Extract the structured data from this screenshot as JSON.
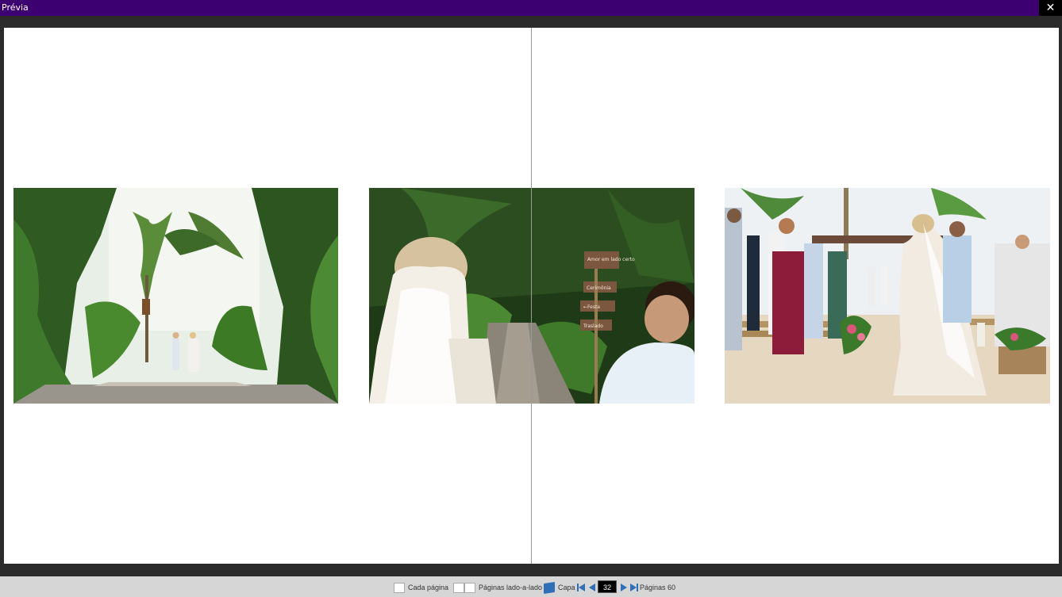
{
  "window": {
    "title": "Prévia",
    "close_label": "✕"
  },
  "spread": {
    "photos": [
      {
        "name": "bride-walkway-photo",
        "alt": "Noiva entrando pelo caminho tropical"
      },
      {
        "name": "bride-and-sign-photo",
        "alt": "Noiva e placa de madeira"
      },
      {
        "name": "beach-ceremony-photo",
        "alt": "Cerimônia na praia"
      }
    ],
    "sign_texts": [
      "Amor em lado certo",
      "Cerimônia",
      "←Festa",
      "Traslado"
    ]
  },
  "toolbar": {
    "each_page_label": "Cada página",
    "side_by_side_label": "Páginas lado-a-lado",
    "cover_label": "Capa",
    "current_page": "32",
    "pages_label": "Páginas 60",
    "accent_color": "#2e6fb8"
  }
}
